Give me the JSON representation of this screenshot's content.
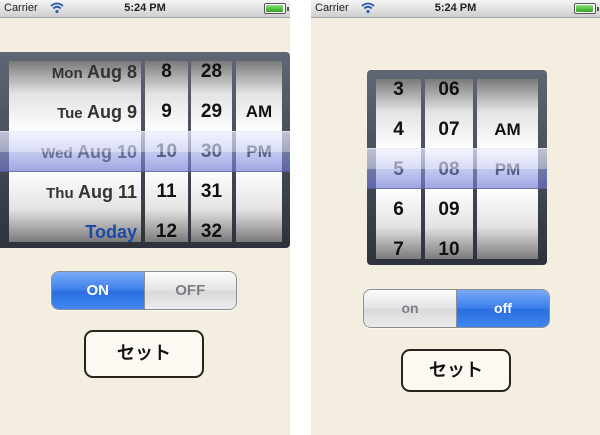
{
  "status_bar": {
    "carrier": "Carrier",
    "time": "5:24 PM"
  },
  "left_screen": {
    "date_wheel": [
      {
        "day": "Mon",
        "label": "Aug 8"
      },
      {
        "day": "Tue",
        "label": "Aug 9"
      },
      {
        "day": "Wed",
        "label": "Aug 10"
      },
      {
        "day": "Thu",
        "label": "Aug 11"
      },
      {
        "day": "",
        "label": "Today"
      }
    ],
    "hour_wheel": [
      "8",
      "9",
      "10",
      "11",
      "12"
    ],
    "minute_wheel": [
      "28",
      "29",
      "30",
      "31",
      "32"
    ],
    "ampm_wheel": [
      "AM",
      "PM"
    ],
    "segment": {
      "on_label": "ON",
      "off_label": "OFF",
      "selected": "ON"
    },
    "set_button": "セット"
  },
  "right_screen": {
    "hour_wheel": [
      "3",
      "4",
      "5",
      "6",
      "7"
    ],
    "minute_wheel": [
      "06",
      "07",
      "08",
      "09",
      "10"
    ],
    "ampm_wheel": [
      "AM",
      "PM"
    ],
    "segment": {
      "on_label": "on",
      "off_label": "off",
      "selected": "off"
    },
    "set_button": "セット"
  },
  "colors": {
    "background": "#f3eee0",
    "accent_blue": "#3b7de8",
    "today_text": "#1d4aa6"
  }
}
